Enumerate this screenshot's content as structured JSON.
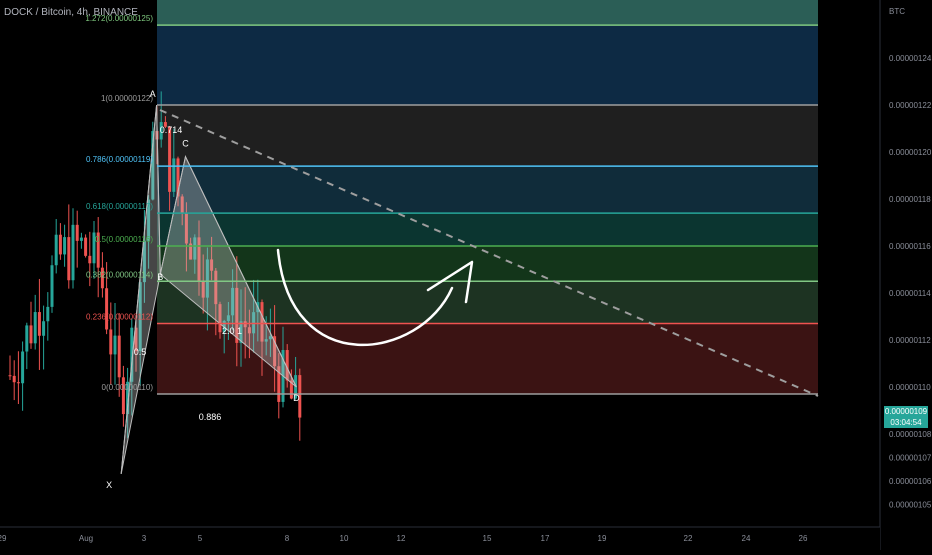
{
  "header": {
    "title": "DOCK / Bitcoin, 4h, BINANCE",
    "currency": "BTC"
  },
  "price_tag": {
    "price": "0.00000109",
    "countdown": "03:04:54"
  },
  "colors": {
    "up": "#26a69a",
    "down": "#ef5350",
    "fib_lines": [
      "#7fc97f",
      "#9e9e9e",
      "#4fc3f7",
      "#26a69a",
      "#4caf50",
      "#81c784",
      "#ef5350",
      "#9e9e9e"
    ],
    "fib_bands": [
      "#2b5e56",
      "#0d2a44",
      "#1f1f1f",
      "#102c3a",
      "#0b3530",
      "#13351a",
      "#1d3322",
      "#3b1313"
    ]
  },
  "chart_data": {
    "type": "candlestick",
    "title": "DOCK / Bitcoin, 4h, BINANCE",
    "y_axis": {
      "unit": "BTC",
      "range": [
        1.045e-06,
        1.27e-06
      ],
      "ticks": [
        "0.00000124",
        "0.00000122",
        "0.00000120",
        "0.00000118",
        "0.00000116",
        "0.00000114",
        "0.00000112",
        "0.00000110",
        "0.00000108",
        "0.00000107",
        "0.00000106",
        "0.00000105"
      ]
    },
    "x_axis": {
      "ticks": [
        "29",
        "Aug",
        "3",
        "5",
        "8",
        "10",
        "12",
        "15",
        "17",
        "19",
        "22",
        "24",
        "26"
      ]
    },
    "fib_levels": [
      {
        "label": "1.272(0.00000125)",
        "price": 1.254e-06
      },
      {
        "label": "1(0.00000122)",
        "price": 1.22e-06
      },
      {
        "label": "0.786(0.00000119)",
        "price": 1.194e-06
      },
      {
        "label": "0.618(0.00000117)",
        "price": 1.174e-06
      },
      {
        "label": "0.5(0.00000116)",
        "price": 1.16e-06
      },
      {
        "label": "0.382(0.00000114)",
        "price": 1.145e-06
      },
      {
        "label": "0.236(0.00000112)",
        "price": 1.127e-06
      },
      {
        "label": "0(0.00000110)",
        "price": 1.097e-06
      }
    ],
    "pattern": {
      "points": [
        {
          "name": "X",
          "x": 0.13,
          "price": 1.063e-06
        },
        {
          "name": "A",
          "x": 0.168,
          "price": 1.22e-06
        },
        {
          "name": "B",
          "x": 0.172,
          "price": 1.148e-06
        },
        {
          "name": "C",
          "x": 0.199,
          "price": 1.198e-06
        },
        {
          "name": "D",
          "x": 0.318,
          "price": 1.1e-06
        }
      ],
      "ratios": [
        "0.714",
        "0.5",
        "2.0 1",
        "0.886"
      ]
    },
    "current_price": 1.09e-06
  }
}
